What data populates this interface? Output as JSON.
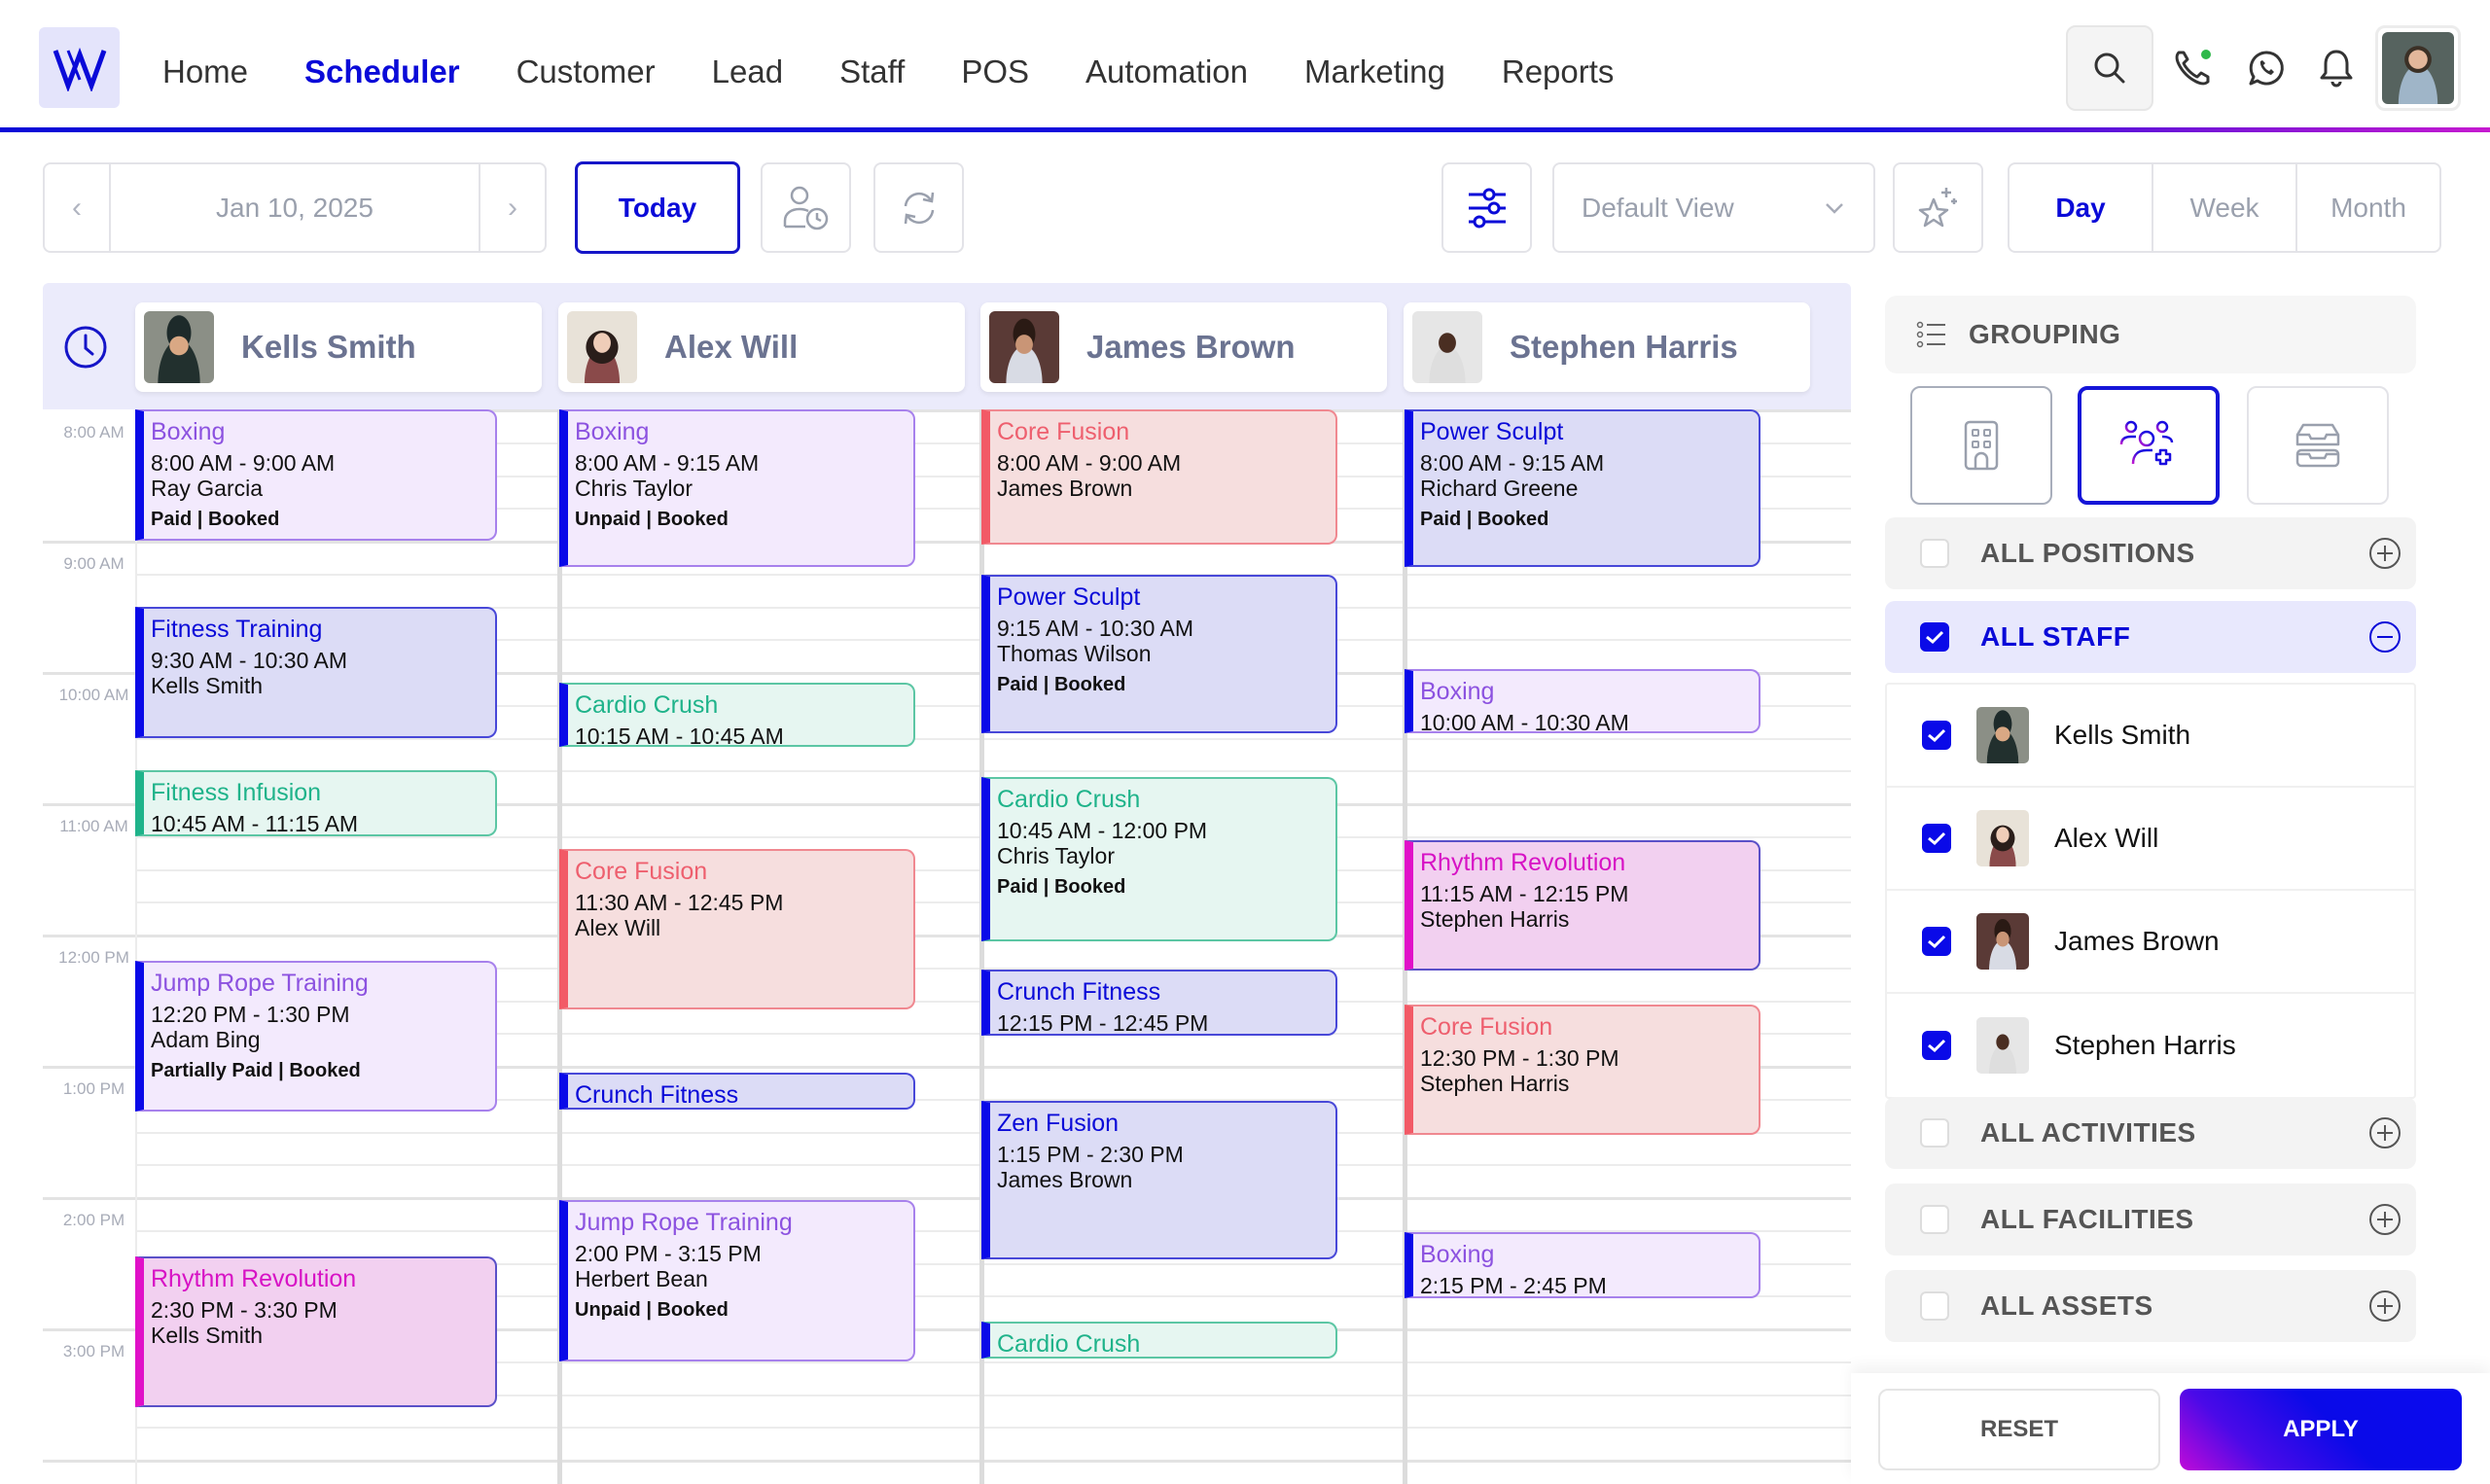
{
  "nav": {
    "logo_letter": "W",
    "items": [
      {
        "label": "Home",
        "active": false
      },
      {
        "label": "Scheduler",
        "active": true
      },
      {
        "label": "Customer",
        "active": false
      },
      {
        "label": "Lead",
        "active": false
      },
      {
        "label": "Staff",
        "active": false
      },
      {
        "label": "POS",
        "active": false
      },
      {
        "label": "Automation",
        "active": false
      },
      {
        "label": "Marketing",
        "active": false
      },
      {
        "label": "Reports",
        "active": false
      }
    ],
    "icons": [
      "search-icon",
      "phone-icon",
      "whatsapp-icon",
      "bell-icon"
    ],
    "phone_status_color": "#2eb84a"
  },
  "toolbar": {
    "date": "Jan 10, 2025",
    "prev_icon": "chevron-left-icon",
    "next_icon": "chevron-right-icon",
    "today_label": "Today",
    "view_select": {
      "value": "Default View"
    },
    "view_modes": [
      {
        "label": "Day",
        "active": true
      },
      {
        "label": "Week",
        "active": false
      },
      {
        "label": "Month",
        "active": false
      }
    ]
  },
  "calendar": {
    "time_labels": [
      "8:00 AM",
      "9:00 AM",
      "10:00 AM",
      "11:00 AM",
      "12:00 PM",
      "1:00 PM",
      "2:00 PM",
      "3:00 PM"
    ],
    "staff": [
      {
        "name": "Kells Smith",
        "events": [
          {
            "title": "Boxing",
            "time": "8:00 AM - 9:00 AM",
            "person": "Ray Garcia",
            "status": "Paid | Booked",
            "color": "purple",
            "start": 8.0,
            "end": 9.0
          },
          {
            "title": "Fitness Training",
            "time": "9:30 AM - 10:30 AM",
            "person": "Kells Smith",
            "status": "",
            "color": "blue",
            "start": 9.5,
            "end": 10.5
          },
          {
            "title": "Fitness Infusion",
            "time": "10:45 AM - 11:15 AM",
            "person": "",
            "status": "",
            "color": "green2",
            "start": 10.75,
            "end": 11.25
          },
          {
            "title": "Jump Rope Training",
            "time": "12:20 PM - 1:30 PM",
            "person": "Adam Bing",
            "status": "Partially Paid | Booked",
            "color": "purple",
            "start": 12.2,
            "end": 13.35
          },
          {
            "title": "Rhythm Revolution",
            "time": "2:30 PM - 3:30 PM",
            "person": "Kells Smith",
            "status": "",
            "color": "pink",
            "start": 14.45,
            "end": 15.6
          }
        ]
      },
      {
        "name": "Alex Will",
        "events": [
          {
            "title": "Boxing",
            "time": "8:00 AM - 9:15 AM",
            "person": "Chris Taylor",
            "status": "Unpaid | Booked",
            "color": "purple",
            "start": 8.0,
            "end": 9.2
          },
          {
            "title": "Cardio Crush",
            "time": "10:15 AM - 10:45 AM",
            "person": "",
            "status": "",
            "color": "green",
            "start": 10.08,
            "end": 10.57
          },
          {
            "title": "Core Fusion",
            "time": "11:30 AM - 12:45 PM",
            "person": "Alex Will",
            "status": "",
            "color": "red",
            "start": 11.35,
            "end": 12.57
          },
          {
            "title": "Crunch Fitness",
            "time": "",
            "person": "",
            "status": "",
            "color": "blue",
            "start": 13.05,
            "end": 13.33
          },
          {
            "title": "Jump Rope Training",
            "time": "2:00 PM - 3:15 PM",
            "person": "Herbert Bean",
            "status": "Unpaid | Booked",
            "color": "purple",
            "start": 14.02,
            "end": 15.25
          }
        ]
      },
      {
        "name": "James Brown",
        "events": [
          {
            "title": "Core Fusion",
            "time": "8:00 AM - 9:00 AM",
            "person": "James Brown",
            "status": "",
            "color": "red",
            "start": 8.0,
            "end": 9.03
          },
          {
            "title": "Power Sculpt",
            "time": "9:15 AM - 10:30 AM",
            "person": "Thomas Wilson",
            "status": "Paid | Booked",
            "color": "blue",
            "start": 9.26,
            "end": 10.47
          },
          {
            "title": "Cardio Crush",
            "time": "10:45 AM - 12:00 PM",
            "person": "Chris Taylor",
            "status": "Paid | Booked",
            "color": "green",
            "start": 10.8,
            "end": 12.05
          },
          {
            "title": "Crunch Fitness",
            "time": "12:15 PM - 12:45 PM",
            "person": "",
            "status": "",
            "color": "blue",
            "start": 12.27,
            "end": 12.77
          },
          {
            "title": "Zen Fusion",
            "time": "1:15 PM - 2:30 PM",
            "person": "James Brown",
            "status": "",
            "color": "blue",
            "start": 13.27,
            "end": 14.48
          },
          {
            "title": "Cardio Crush",
            "time": "",
            "person": "",
            "status": "",
            "color": "green",
            "start": 14.95,
            "end": 15.23
          }
        ]
      },
      {
        "name": "Stephen Harris",
        "events": [
          {
            "title": "Power Sculpt",
            "time": "8:00 AM - 9:15 AM",
            "person": "Richard Greene",
            "status": "Paid | Booked",
            "color": "blue",
            "start": 8.0,
            "end": 9.2
          },
          {
            "title": "Boxing",
            "time": "10:00 AM - 10:30 AM",
            "person": "",
            "status": "",
            "color": "purple",
            "start": 9.98,
            "end": 10.47
          },
          {
            "title": "Rhythm Revolution",
            "time": "11:15 AM - 12:15 PM",
            "person": "Stephen Harris",
            "status": "",
            "color": "pink",
            "start": 11.28,
            "end": 12.27
          },
          {
            "title": "Core Fusion",
            "time": "12:30 PM - 1:30 PM",
            "person": "Stephen Harris",
            "status": "",
            "color": "red",
            "start": 12.53,
            "end": 13.52
          },
          {
            "title": "Boxing",
            "time": "2:15 PM - 2:45 PM",
            "person": "",
            "status": "",
            "color": "purple",
            "start": 14.27,
            "end": 14.77
          }
        ]
      }
    ]
  },
  "panel": {
    "grouping_label": "GROUPING",
    "grouping_options": [
      {
        "icon": "building-icon",
        "active": false
      },
      {
        "icon": "staff-group-icon",
        "active": true
      },
      {
        "icon": "inbox-tray-icon",
        "active": false
      }
    ],
    "filters": [
      {
        "label": "ALL POSITIONS",
        "checked": false,
        "expanded": false
      },
      {
        "label": "ALL STAFF",
        "checked": true,
        "expanded": true
      },
      {
        "label": "ALL ACTIVITIES",
        "checked": false,
        "expanded": false
      },
      {
        "label": "ALL FACILITIES",
        "checked": false,
        "expanded": false
      },
      {
        "label": "ALL ASSETS",
        "checked": false,
        "expanded": false
      }
    ],
    "staff_list": [
      {
        "name": "Kells Smith",
        "checked": true
      },
      {
        "name": "Alex Will",
        "checked": true
      },
      {
        "name": "James Brown",
        "checked": true
      },
      {
        "name": "Stephen Harris",
        "checked": true
      }
    ],
    "reset_label": "RESET",
    "apply_label": "APPLY"
  },
  "colors": {
    "accent": "#0a0ad8",
    "accent_secondary": "#c61ad0"
  }
}
